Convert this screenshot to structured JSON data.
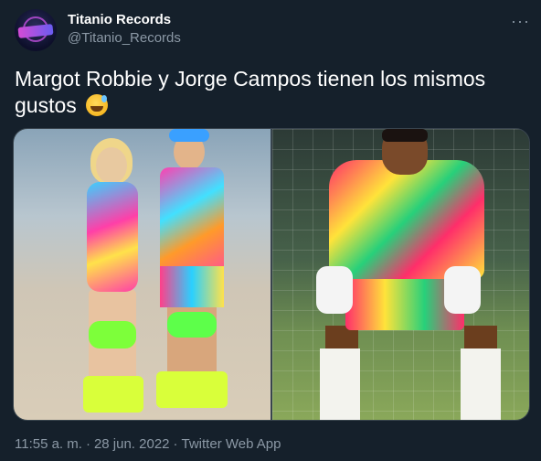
{
  "account": {
    "display_name": "Titanio Records",
    "handle": "@Titanio_Records",
    "avatar_icon": "titanio-records-logo"
  },
  "tweet": {
    "text": "Margot Robbie y Jorge Campos tienen los mismos gustos",
    "emoji": "grinning-face-with-sweat"
  },
  "media": {
    "count": 2
  },
  "footer": {
    "time": "11:55 a. m.",
    "date": "28 jun. 2022",
    "source": "Twitter Web App"
  },
  "icons": {
    "more": "more-options-icon"
  },
  "colors": {
    "background": "#15202b",
    "secondary_text": "#8b98a5",
    "primary_text": "#ffffff"
  }
}
